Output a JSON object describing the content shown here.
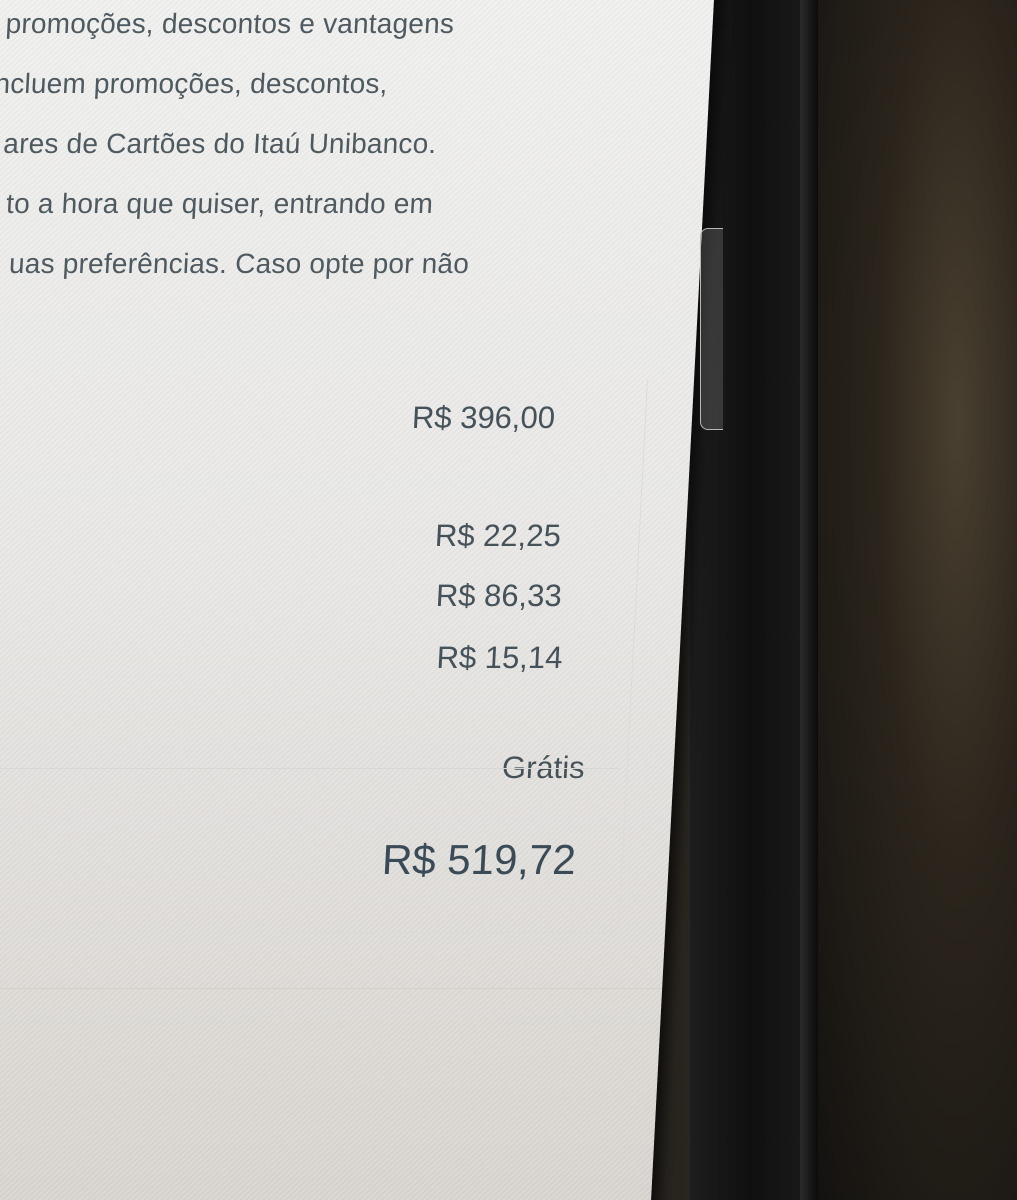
{
  "notice": {
    "lines": [
      "promoções, descontos e vantagens",
      "ncluem promoções, descontos,",
      "ares de Cartões do Itaú Unibanco.",
      "to a hora que quiser, entrando em",
      "uas preferências. Caso opte por não"
    ]
  },
  "summary": {
    "subtotal": "R$ 396,00",
    "charges": [
      "R$ 22,25",
      "R$ 86,33",
      "R$ 15,14"
    ],
    "shipping": "Grátis",
    "total": "R$ 519,72"
  }
}
